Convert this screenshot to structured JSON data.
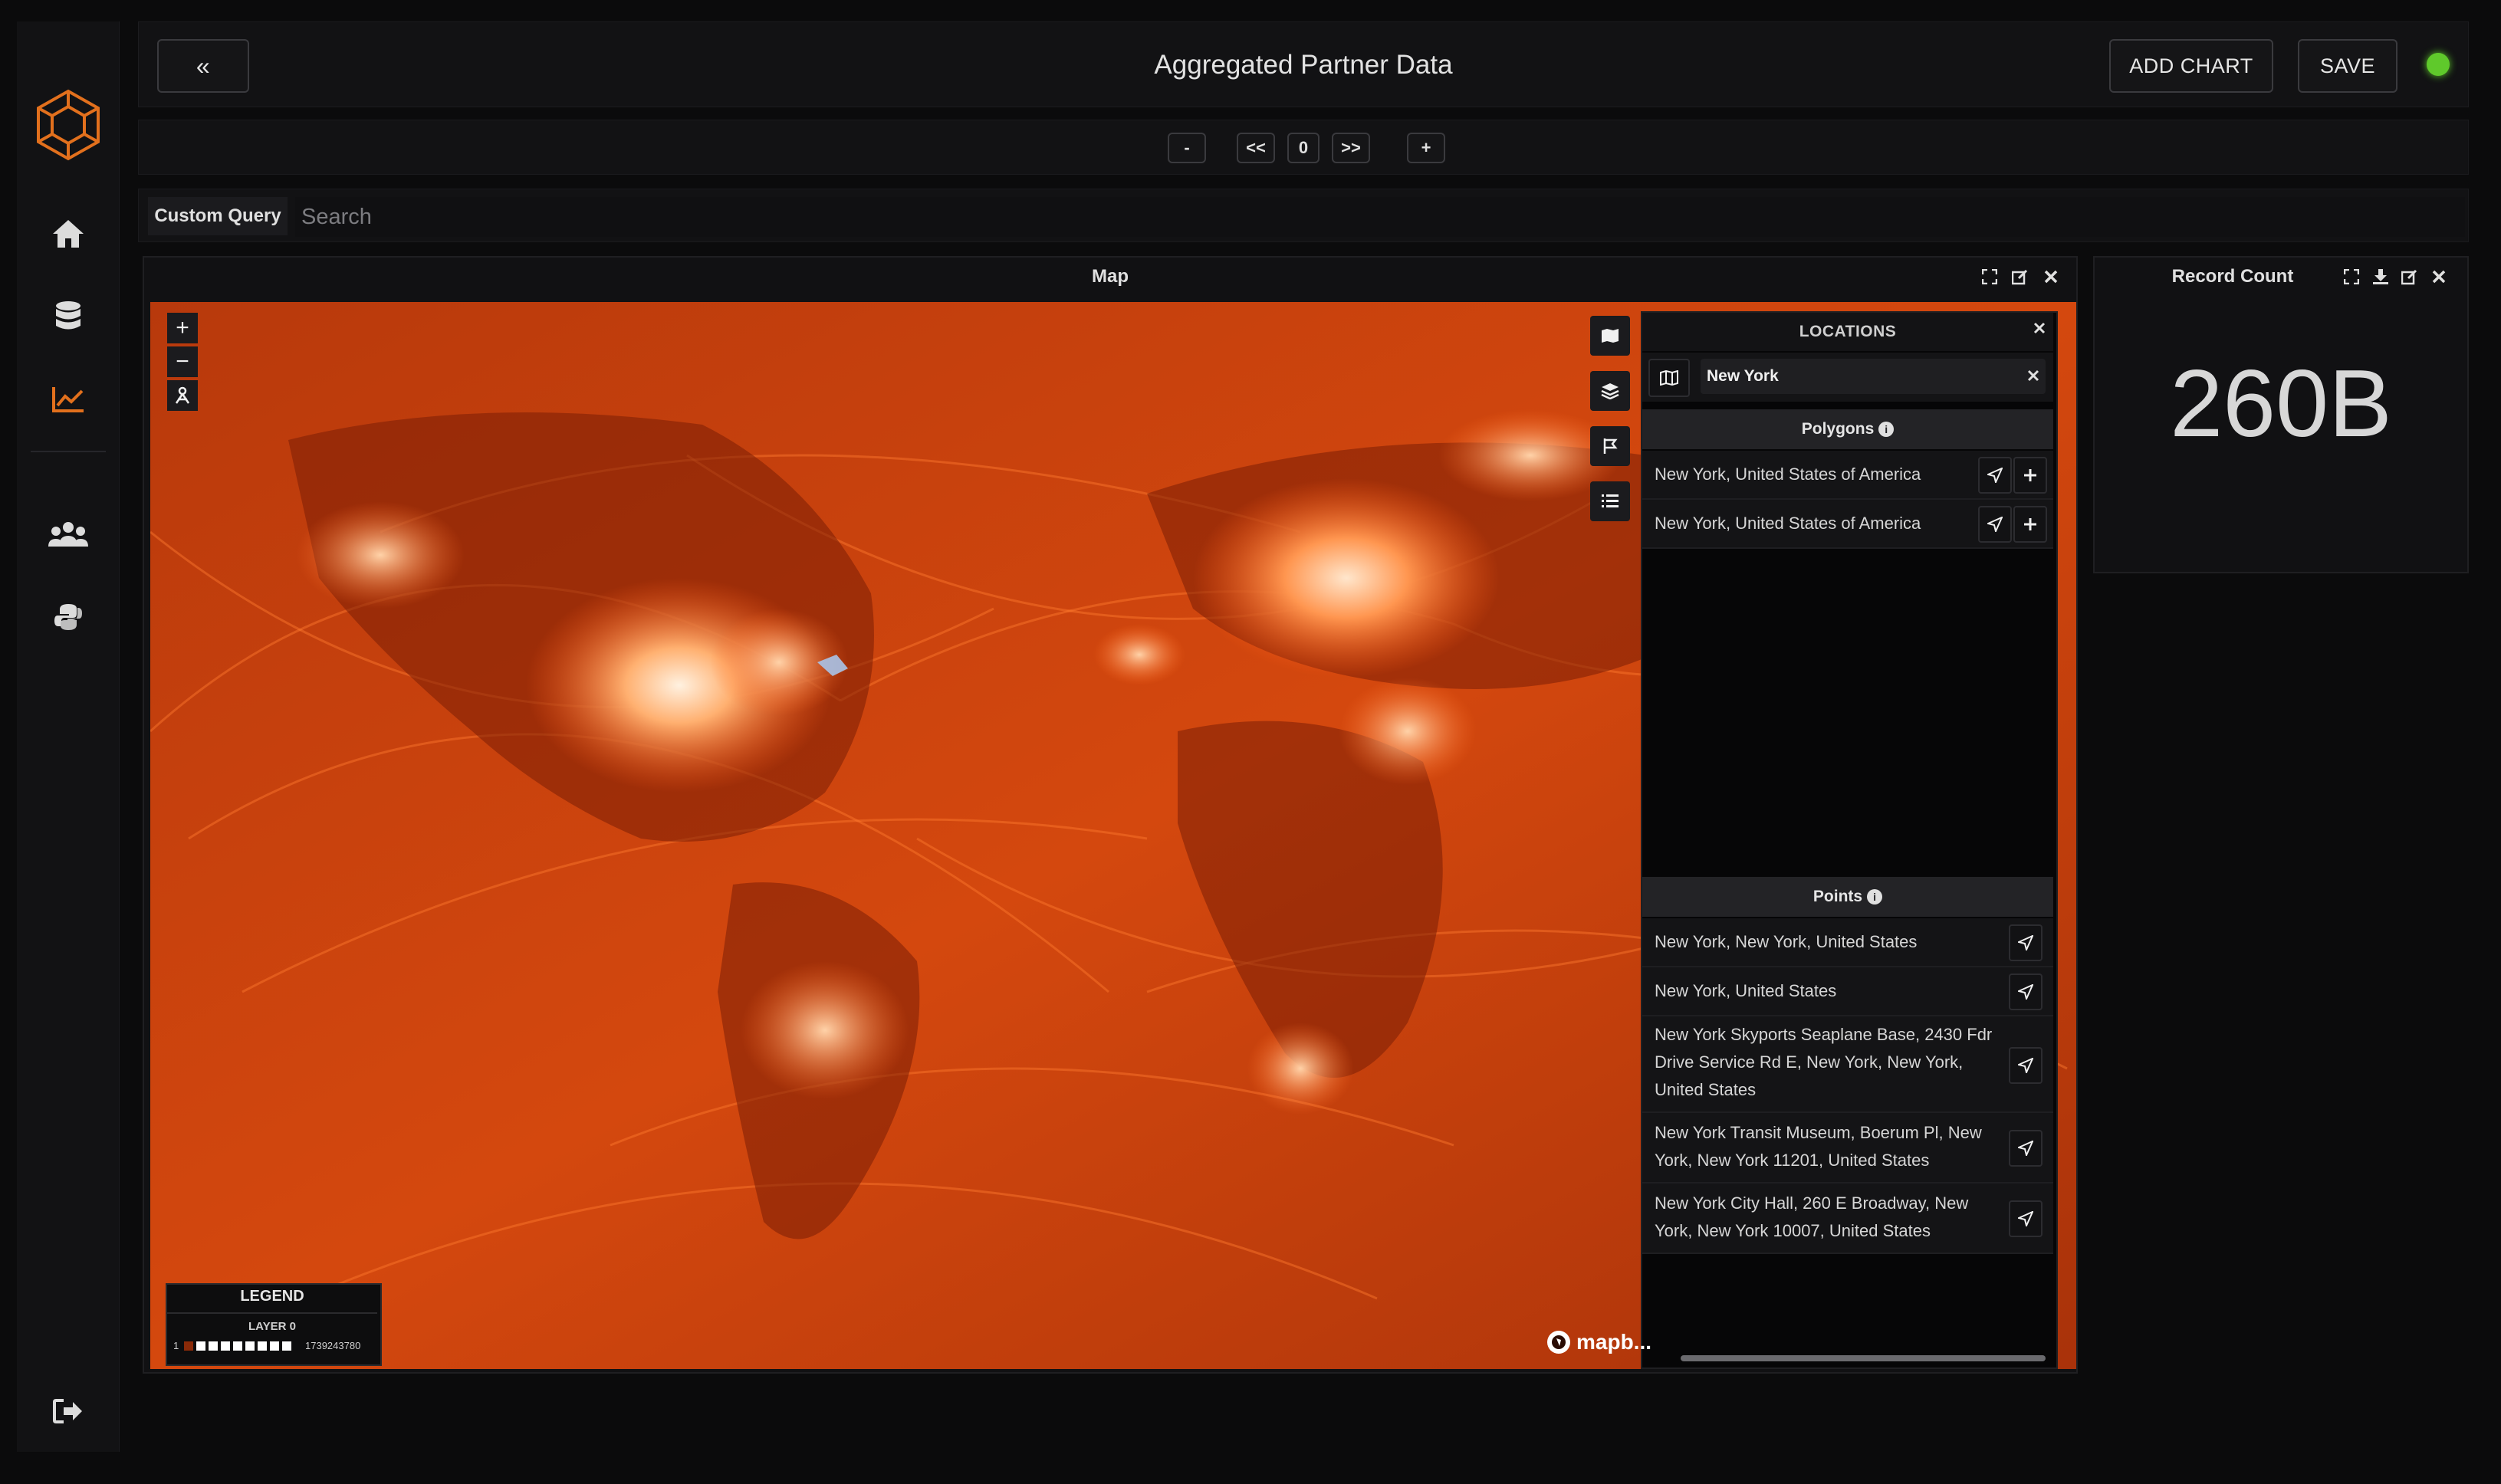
{
  "header": {
    "back_label": "«",
    "title": "Aggregated Partner Data",
    "add_chart_label": "ADD CHART",
    "save_label": "SAVE",
    "status_color": "#5fc92b"
  },
  "pager": {
    "minus": "-",
    "prev": "<<",
    "page": "0",
    "next": ">>",
    "plus": "+"
  },
  "query": {
    "mode_label": "Custom Query",
    "search_placeholder": "Search"
  },
  "map_panel": {
    "title": "Map",
    "attribution": "mapb...",
    "legend": {
      "title": "LEGEND",
      "layer": "LAYER 0",
      "min": "1",
      "max": "1739243780"
    }
  },
  "locations": {
    "title": "LOCATIONS",
    "query_value": "New York",
    "polygons_heading": "Polygons",
    "polygons": [
      "New York, United States of America",
      "New York, United States of America"
    ],
    "points_heading": "Points",
    "points": [
      {
        "line1": "New York, New York, United States"
      },
      {
        "line1": "New York, United States"
      },
      {
        "line1": "New York Skyports Seaplane Base, 2430 Fdr",
        "line2": "Drive Service Rd E, New York, New York,",
        "line3": "United States"
      },
      {
        "line1": "New York Transit Museum, Boerum Pl, New",
        "line2": "York, New York 11201, United States"
      },
      {
        "line1": "New York City Hall, 260 E Broadway, New",
        "line2": "York, New York 10007, United States"
      }
    ]
  },
  "record_count": {
    "title": "Record Count",
    "value": "260B"
  },
  "colors": {
    "accent_orange": "#e2701d",
    "map_glow": "#ff5a14",
    "background": "#0b0b0c"
  }
}
